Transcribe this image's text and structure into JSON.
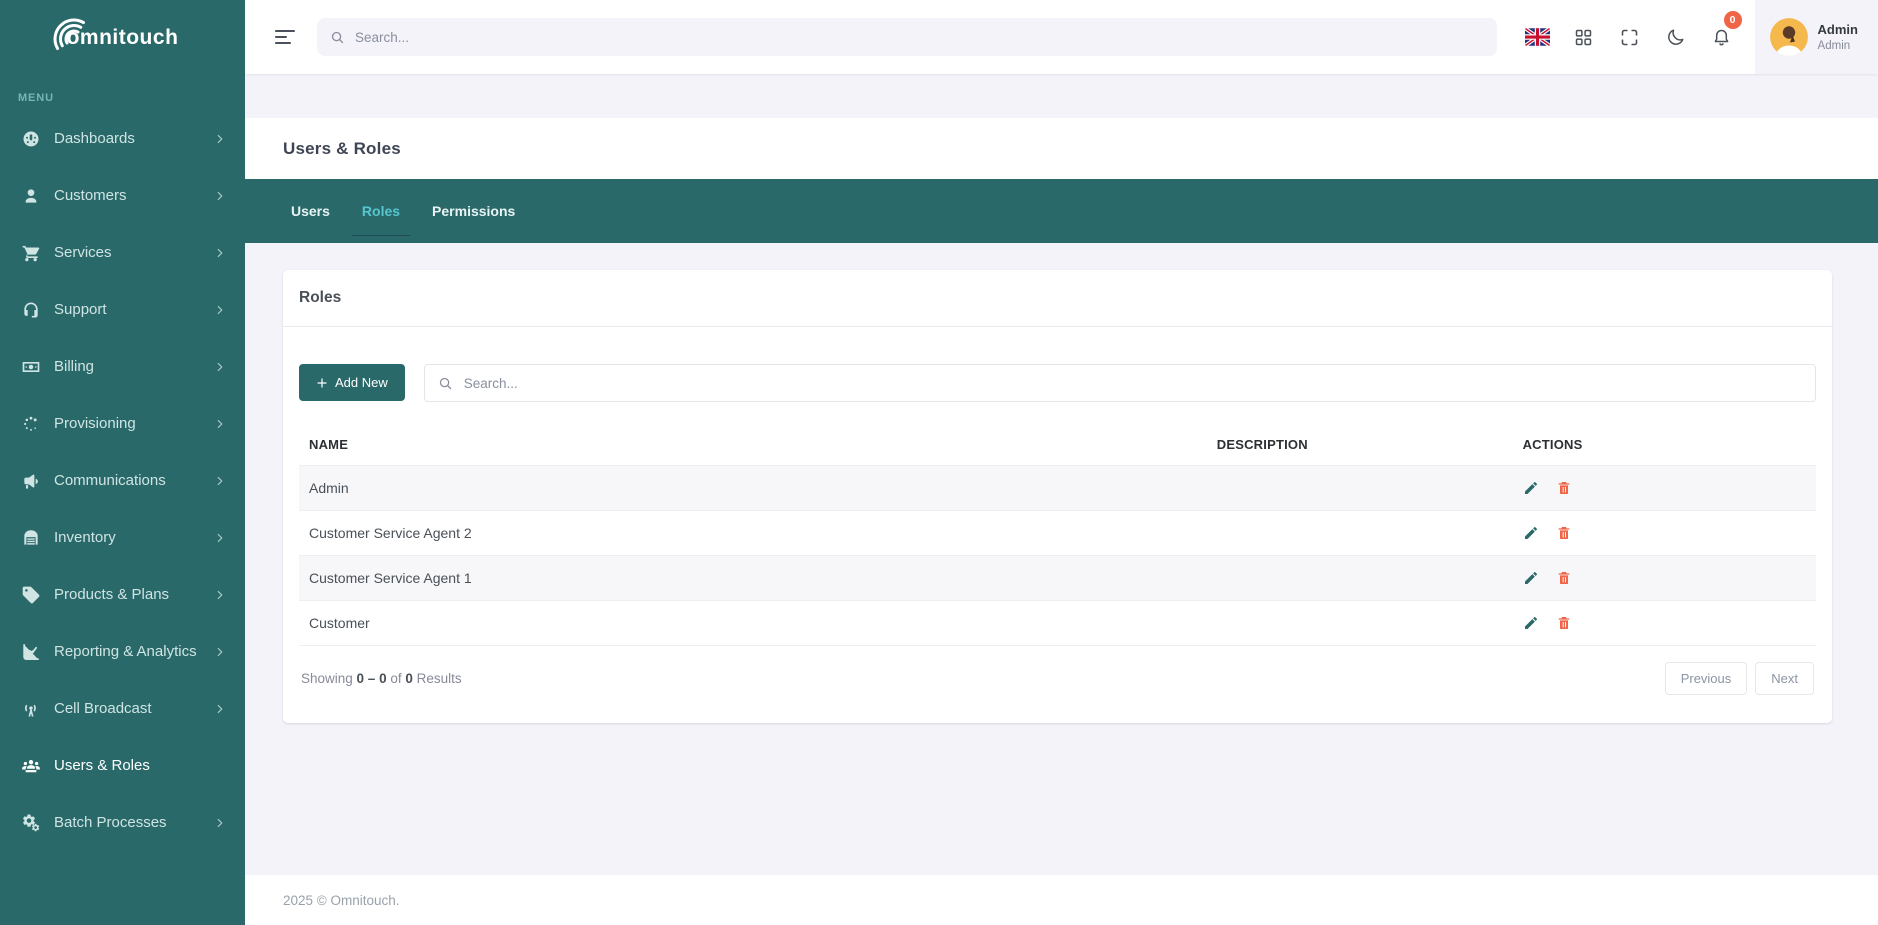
{
  "brand": {
    "name": "omnitouch"
  },
  "sidebar": {
    "menu_label": "MENU",
    "items": [
      {
        "label": "Dashboards"
      },
      {
        "label": "Customers"
      },
      {
        "label": "Services"
      },
      {
        "label": "Support"
      },
      {
        "label": "Billing"
      },
      {
        "label": "Provisioning"
      },
      {
        "label": "Communications"
      },
      {
        "label": "Inventory"
      },
      {
        "label": "Products & Plans"
      },
      {
        "label": "Reporting & Analytics"
      },
      {
        "label": "Cell Broadcast"
      },
      {
        "label": "Users & Roles"
      },
      {
        "label": "Batch Processes"
      }
    ]
  },
  "topbar": {
    "search_placeholder": "Search...",
    "notification_count": "0",
    "user": {
      "name": "Admin",
      "role": "Admin"
    }
  },
  "page": {
    "title": "Users & Roles",
    "tabs": [
      {
        "label": "Users"
      },
      {
        "label": "Roles"
      },
      {
        "label": "Permissions"
      }
    ],
    "active_tab": "Roles"
  },
  "card": {
    "title": "Roles",
    "add_button": "Add New",
    "search_placeholder": "Search...",
    "table": {
      "columns": [
        "NAME",
        "DESCRIPTION",
        "ACTIONS"
      ],
      "rows": [
        {
          "name": "Admin",
          "description": ""
        },
        {
          "name": "Customer Service Agent 2",
          "description": ""
        },
        {
          "name": "Customer Service Agent 1",
          "description": ""
        },
        {
          "name": "Customer",
          "description": ""
        }
      ]
    },
    "summary": {
      "prefix": "Showing ",
      "range": "0 – 0",
      "middle": " of ",
      "total": "0",
      "suffix": " Results"
    },
    "pagination": {
      "previous": "Previous",
      "next": "Next"
    }
  },
  "footer": {
    "copyright": "2025 © Omnitouch."
  },
  "colors": {
    "sidebar_teal": "#2a696a",
    "accent_cyan": "#57c6cf",
    "danger_red": "#f06548",
    "body_bg": "#f3f3f9",
    "avatar_bg": "#f5b84d"
  }
}
